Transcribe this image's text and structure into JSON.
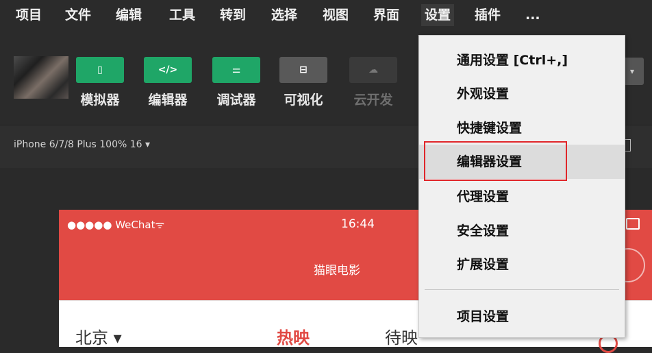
{
  "menubar": {
    "items": [
      "项目",
      "文件",
      "编辑",
      "工具",
      "转到",
      "选择",
      "视图",
      "界面",
      "设置",
      "插件",
      "..."
    ]
  },
  "toolbar": {
    "tools": [
      {
        "label": "模拟器",
        "icon": "▯"
      },
      {
        "label": "编辑器",
        "icon": "</>"
      },
      {
        "label": "调试器",
        "icon": "⚌"
      },
      {
        "label": "可视化",
        "icon": "⊟"
      },
      {
        "label": "云开发",
        "icon": "☁"
      }
    ],
    "right_icon": "▾"
  },
  "devicebar": {
    "device": "iPhone 6/7/8 Plus 100% 16 ▾"
  },
  "simulator": {
    "carrier": "●●●●● WeChat",
    "wifi": "ᯤ",
    "time": "16:44",
    "title": "猫眼电影",
    "city": "北京 ▾",
    "tab_hot": "热映",
    "tab_soon": "待映"
  },
  "dropdown": {
    "items": [
      "通用设置 [Ctrl+,]",
      "外观设置",
      "快捷键设置",
      "编辑器设置",
      "代理设置",
      "安全设置",
      "扩展设置"
    ],
    "footer": "项目设置"
  },
  "colors": {
    "accent_green": "#1fa667",
    "brand_red": "#e14a44",
    "highlight_box": "#e0262a"
  }
}
